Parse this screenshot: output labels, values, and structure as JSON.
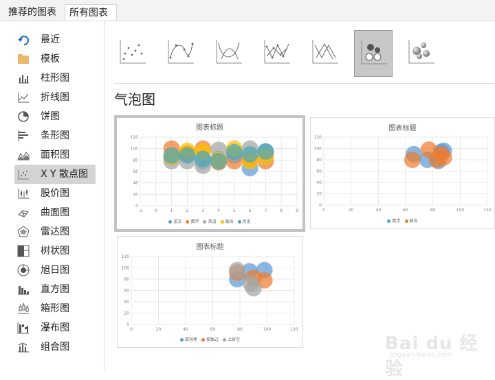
{
  "tabs": {
    "recommended": "推荐的图表",
    "all": "所有图表"
  },
  "sidebar": {
    "items": [
      {
        "label": "最近",
        "icon": "recent-icon"
      },
      {
        "label": "模板",
        "icon": "folder-icon"
      },
      {
        "label": "柱形图",
        "icon": "column-chart-icon"
      },
      {
        "label": "折线图",
        "icon": "line-chart-icon"
      },
      {
        "label": "饼图",
        "icon": "pie-chart-icon"
      },
      {
        "label": "条形图",
        "icon": "bar-chart-icon"
      },
      {
        "label": "面积图",
        "icon": "area-chart-icon"
      },
      {
        "label": "X Y 散点图",
        "icon": "scatter-chart-icon"
      },
      {
        "label": "股价图",
        "icon": "stock-chart-icon"
      },
      {
        "label": "曲面图",
        "icon": "surface-chart-icon"
      },
      {
        "label": "雷达图",
        "icon": "radar-chart-icon"
      },
      {
        "label": "树状图",
        "icon": "treemap-chart-icon"
      },
      {
        "label": "旭日图",
        "icon": "sunburst-chart-icon"
      },
      {
        "label": "直方图",
        "icon": "histogram-chart-icon"
      },
      {
        "label": "箱形图",
        "icon": "box-whisker-chart-icon"
      },
      {
        "label": "瀑布图",
        "icon": "waterfall-chart-icon"
      },
      {
        "label": "组合图",
        "icon": "combo-chart-icon"
      }
    ],
    "selected_index": 7
  },
  "subtypes": [
    {
      "icon": "scatter-icon"
    },
    {
      "icon": "scatter-smooth-lines-markers-icon"
    },
    {
      "icon": "scatter-smooth-lines-icon"
    },
    {
      "icon": "scatter-straight-lines-markers-icon"
    },
    {
      "icon": "scatter-straight-lines-icon"
    },
    {
      "icon": "bubble-icon"
    },
    {
      "icon": "3d-bubble-icon"
    }
  ],
  "selected_subtype_index": 5,
  "section_title": "气泡图",
  "colors": {
    "blue": "#5b9bd5",
    "orange": "#ed7d31",
    "gray": "#a5a5a5",
    "gold": "#ffc000",
    "teal": "#4ea7b4"
  },
  "chart_data": [
    {
      "type": "scatter",
      "variant": "bubble",
      "title": "图表标题",
      "xlim": [
        -1,
        9
      ],
      "ylim": [
        0,
        120
      ],
      "x_ticks": [
        "-1",
        "0",
        "1",
        "2",
        "3",
        "4",
        "5",
        "6",
        "7",
        "8",
        "9"
      ],
      "y_ticks": [
        "0",
        "20",
        "40",
        "60",
        "80",
        "100",
        "120"
      ],
      "series": [
        {
          "name": "语文",
          "color": "#5b9bd5",
          "points": [
            [
              1,
              85
            ],
            [
              2,
              90
            ],
            [
              3,
              78
            ],
            [
              4,
              82
            ],
            [
              5,
              88
            ],
            [
              6,
              66
            ],
            [
              7,
              95
            ]
          ]
        },
        {
          "name": "数学",
          "color": "#ed7d31",
          "points": [
            [
              1,
              100
            ],
            [
              2,
              92
            ],
            [
              3,
              100
            ],
            [
              4,
              76
            ],
            [
              5,
              78
            ],
            [
              6,
              82
            ],
            [
              7,
              78
            ]
          ]
        },
        {
          "name": "英语",
          "color": "#a5a5a5",
          "points": [
            [
              1,
              78
            ],
            [
              2,
              78
            ],
            [
              3,
              70
            ],
            [
              4,
              98
            ],
            [
              5,
              90
            ],
            [
              6,
              100
            ],
            [
              7,
              88
            ]
          ]
        },
        {
          "name": "政治",
          "color": "#ffc000",
          "points": [
            [
              1,
              86
            ],
            [
              2,
              96
            ],
            [
              3,
              95
            ],
            [
              4,
              80
            ],
            [
              5,
              100
            ],
            [
              6,
              78
            ],
            [
              7,
              86
            ]
          ]
        },
        {
          "name": "历史",
          "color": "#4ea7b4",
          "points": [
            [
              1,
              88
            ],
            [
              2,
              88
            ],
            [
              3,
              82
            ],
            [
              4,
              78
            ],
            [
              5,
              94
            ],
            [
              6,
              90
            ],
            [
              7,
              95
            ]
          ]
        }
      ]
    },
    {
      "type": "scatter",
      "variant": "bubble",
      "title": "图表标题",
      "xlim": [
        0,
        120
      ],
      "ylim": [
        0,
        120
      ],
      "x_ticks": [
        "0",
        "20",
        "40",
        "60",
        "80",
        "100",
        "120"
      ],
      "y_ticks": [
        "0",
        "20",
        "40",
        "60",
        "80",
        "100",
        "120"
      ],
      "series": [
        {
          "name": "数学",
          "color": "#5b9bd5",
          "points": [
            [
              66,
              90
            ],
            [
              76,
              80
            ],
            [
              84,
              78
            ],
            [
              86,
              94
            ],
            [
              88,
              96
            ]
          ]
        },
        {
          "name": "政治",
          "color": "#ed7d31",
          "points": [
            [
              65,
              80
            ],
            [
              77,
              98
            ],
            [
              83,
              80
            ],
            [
              86,
              90
            ],
            [
              88,
              84
            ]
          ]
        }
      ]
    },
    {
      "type": "scatter",
      "variant": "bubble",
      "title": "图表标题",
      "xlim": [
        0,
        120
      ],
      "ylim": [
        0,
        120
      ],
      "x_ticks": [
        "0",
        "20",
        "40",
        "60",
        "80",
        "100",
        "120"
      ],
      "y_ticks": [
        "0",
        "20",
        "40",
        "60",
        "80",
        "100",
        "120"
      ],
      "series": [
        {
          "name": "慕容亮",
          "color": "#5b9bd5",
          "points": [
            [
              78,
              80
            ],
            [
              87,
              94
            ],
            [
              98,
              96
            ]
          ]
        },
        {
          "name": "孤独过",
          "color": "#ed7d31",
          "points": [
            [
              78,
              92
            ],
            [
              90,
              82
            ],
            [
              98,
              78
            ]
          ]
        },
        {
          "name": "上官空",
          "color": "#a5a5a5",
          "points": [
            [
              78,
              96
            ],
            [
              88,
              72
            ],
            [
              90,
              64
            ]
          ]
        }
      ]
    }
  ],
  "watermark": {
    "brand": "Bai du 经验",
    "url": "jingyan.baidu.com"
  }
}
